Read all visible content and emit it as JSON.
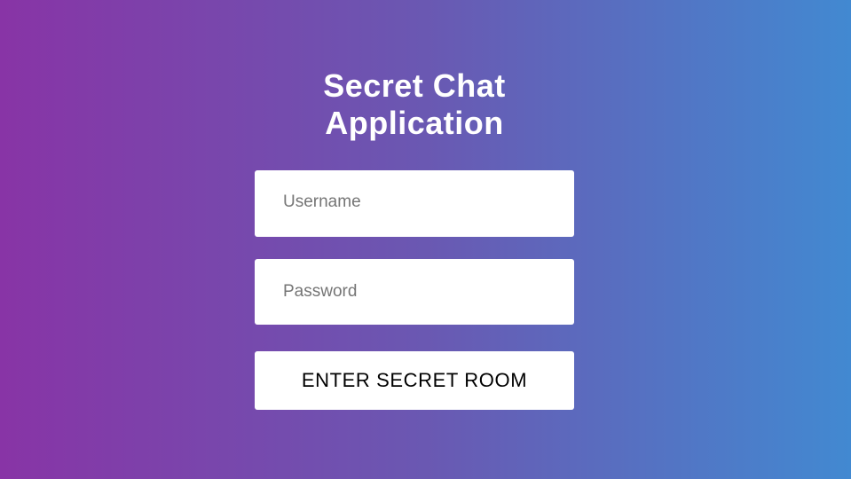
{
  "app": {
    "title_line1": "Secret Chat",
    "title_line2": "Application"
  },
  "form": {
    "username": {
      "placeholder": "Username",
      "value": ""
    },
    "password": {
      "placeholder": "Password",
      "value": ""
    },
    "submit_label": "ENTER SECRET ROOM"
  },
  "colors": {
    "gradient_start": "#8834a6",
    "gradient_end": "#4289d1",
    "field_background": "#ffffff",
    "title_text": "#ffffff"
  }
}
